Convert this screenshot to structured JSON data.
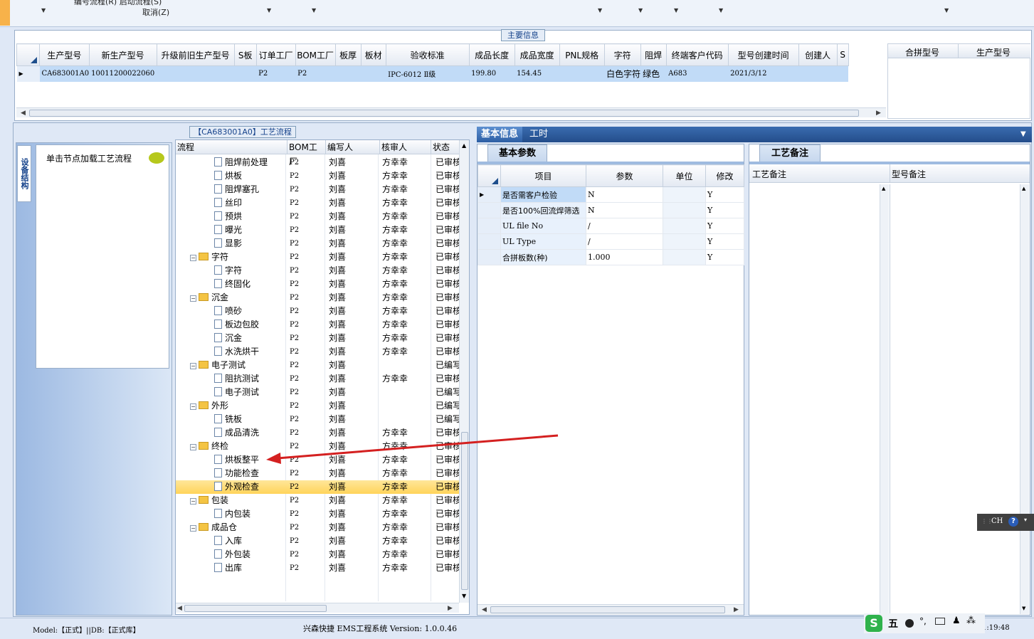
{
  "toolbar": {
    "line1": "编号流程(R)    启动流程(S)",
    "line2": "取消(Z)"
  },
  "main_info": {
    "caption": "主要信息",
    "columns": [
      "生产型号",
      "新生产型号",
      "升级前旧生产型号",
      "S板",
      "订单工厂",
      "BOM工厂",
      "板厚",
      "板材",
      "验收标准",
      "成品长度",
      "成品宽度",
      "PNL规格",
      "字符",
      "阻焊",
      "终端客户代码",
      "型号创建时间",
      "创建人",
      "S"
    ],
    "row": [
      "CA683001A0",
      "10011200022060",
      "",
      "",
      "P2",
      "P2",
      "",
      "",
      "IPC-6012 Ⅱ级",
      "199.80",
      "154.45",
      "",
      "白色字符",
      "绿色",
      "A683",
      "2021/3/12",
      "",
      ""
    ],
    "merge_columns": [
      "合拼型号",
      "生产型号"
    ]
  },
  "left": {
    "vertical_tab": "设备结构",
    "node_hint": "单击节点加载工艺流程"
  },
  "flow": {
    "caption": "【CA683001A0】工艺流程",
    "columns": [
      "流程",
      "BOM工厂",
      "编写人",
      "核审人",
      "状态"
    ],
    "rows": [
      {
        "level": 2,
        "type": "doc",
        "name": "阻焊前处理",
        "bom": "P2",
        "writer": "刘喜",
        "checker": "方幸幸",
        "status": "已审核"
      },
      {
        "level": 2,
        "type": "doc",
        "name": "烘板",
        "bom": "P2",
        "writer": "刘喜",
        "checker": "方幸幸",
        "status": "已审核"
      },
      {
        "level": 2,
        "type": "doc",
        "name": "阻焊塞孔",
        "bom": "P2",
        "writer": "刘喜",
        "checker": "方幸幸",
        "status": "已审核"
      },
      {
        "level": 2,
        "type": "doc",
        "name": "丝印",
        "bom": "P2",
        "writer": "刘喜",
        "checker": "方幸幸",
        "status": "已审核"
      },
      {
        "level": 2,
        "type": "doc",
        "name": "预烘",
        "bom": "P2",
        "writer": "刘喜",
        "checker": "方幸幸",
        "status": "已审核"
      },
      {
        "level": 2,
        "type": "doc",
        "name": "曝光",
        "bom": "P2",
        "writer": "刘喜",
        "checker": "方幸幸",
        "status": "已审核"
      },
      {
        "level": 2,
        "type": "doc",
        "name": "显影",
        "bom": "P2",
        "writer": "刘喜",
        "checker": "方幸幸",
        "status": "已审核"
      },
      {
        "level": 1,
        "type": "folder",
        "name": "字符",
        "bom": "P2",
        "writer": "刘喜",
        "checker": "方幸幸",
        "status": "已审核"
      },
      {
        "level": 2,
        "type": "doc",
        "name": "字符",
        "bom": "P2",
        "writer": "刘喜",
        "checker": "方幸幸",
        "status": "已审核"
      },
      {
        "level": 2,
        "type": "doc",
        "name": "终固化",
        "bom": "P2",
        "writer": "刘喜",
        "checker": "方幸幸",
        "status": "已审核"
      },
      {
        "level": 1,
        "type": "folder",
        "name": "沉金",
        "bom": "P2",
        "writer": "刘喜",
        "checker": "方幸幸",
        "status": "已审核"
      },
      {
        "level": 2,
        "type": "doc",
        "name": "喷砂",
        "bom": "P2",
        "writer": "刘喜",
        "checker": "方幸幸",
        "status": "已审核"
      },
      {
        "level": 2,
        "type": "doc",
        "name": "板边包胶",
        "bom": "P2",
        "writer": "刘喜",
        "checker": "方幸幸",
        "status": "已审核"
      },
      {
        "level": 2,
        "type": "doc",
        "name": "沉金",
        "bom": "P2",
        "writer": "刘喜",
        "checker": "方幸幸",
        "status": "已审核"
      },
      {
        "level": 2,
        "type": "doc",
        "name": "水洗烘干",
        "bom": "P2",
        "writer": "刘喜",
        "checker": "方幸幸",
        "status": "已审核"
      },
      {
        "level": 1,
        "type": "folder",
        "name": "电子测试",
        "bom": "P2",
        "writer": "刘喜",
        "checker": "",
        "status": "已编写"
      },
      {
        "level": 2,
        "type": "doc",
        "name": "阻抗测试",
        "bom": "P2",
        "writer": "刘喜",
        "checker": "方幸幸",
        "status": "已审核"
      },
      {
        "level": 2,
        "type": "doc",
        "name": "电子测试",
        "bom": "P2",
        "writer": "刘喜",
        "checker": "",
        "status": "已编写"
      },
      {
        "level": 1,
        "type": "folder",
        "name": "外形",
        "bom": "P2",
        "writer": "刘喜",
        "checker": "",
        "status": "已编写"
      },
      {
        "level": 2,
        "type": "doc",
        "name": "铣板",
        "bom": "P2",
        "writer": "刘喜",
        "checker": "",
        "status": "已编写"
      },
      {
        "level": 2,
        "type": "doc",
        "name": "成品清洗",
        "bom": "P2",
        "writer": "刘喜",
        "checker": "方幸幸",
        "status": "已审核"
      },
      {
        "level": 1,
        "type": "folder",
        "name": "终检",
        "bom": "P2",
        "writer": "刘喜",
        "checker": "方幸幸",
        "status": "已审核"
      },
      {
        "level": 2,
        "type": "doc",
        "name": "烘板整平",
        "bom": "P2",
        "writer": "刘喜",
        "checker": "方幸幸",
        "status": "已审核"
      },
      {
        "level": 2,
        "type": "doc",
        "name": "功能检查",
        "bom": "P2",
        "writer": "刘喜",
        "checker": "方幸幸",
        "status": "已审核"
      },
      {
        "level": 2,
        "type": "doc",
        "name": "外观检查",
        "bom": "P2",
        "writer": "刘喜",
        "checker": "方幸幸",
        "status": "已审核",
        "selected": true
      },
      {
        "level": 1,
        "type": "folder",
        "name": "包装",
        "bom": "P2",
        "writer": "刘喜",
        "checker": "方幸幸",
        "status": "已审核"
      },
      {
        "level": 2,
        "type": "doc",
        "name": "内包装",
        "bom": "P2",
        "writer": "刘喜",
        "checker": "方幸幸",
        "status": "已审核"
      },
      {
        "level": 1,
        "type": "folder",
        "name": "成品仓",
        "bom": "P2",
        "writer": "刘喜",
        "checker": "方幸幸",
        "status": "已审核"
      },
      {
        "level": 2,
        "type": "doc",
        "name": "入库",
        "bom": "P2",
        "writer": "刘喜",
        "checker": "方幸幸",
        "status": "已审核"
      },
      {
        "level": 2,
        "type": "doc",
        "name": "外包装",
        "bom": "P2",
        "writer": "刘喜",
        "checker": "方幸幸",
        "status": "已审核"
      },
      {
        "level": 2,
        "type": "doc",
        "name": "出库",
        "bom": "P2",
        "writer": "刘喜",
        "checker": "方幸幸",
        "status": "已审核"
      }
    ]
  },
  "right_tabs": [
    "基本信息",
    "工时"
  ],
  "params": {
    "tab": "基本参数",
    "columns": [
      "项目",
      "参数",
      "单位",
      "修改"
    ],
    "rows": [
      {
        "item": "是否需客户检验",
        "value": "N",
        "unit": "",
        "edit": "Y"
      },
      {
        "item": "是否100%回流焊筛选",
        "value": "N",
        "unit": "",
        "edit": "Y"
      },
      {
        "item": "UL file No",
        "value": "/",
        "unit": "",
        "edit": "Y"
      },
      {
        "item": "UL Type",
        "value": "/",
        "unit": "",
        "edit": "Y"
      },
      {
        "item": "合拼板数(种)",
        "value": "1.000",
        "unit": "",
        "edit": "Y"
      }
    ]
  },
  "notes": {
    "tab": "工艺备注",
    "col1": "工艺备注",
    "col2": "型号备注"
  },
  "status_bar": {
    "left": "Model:【正式】||DB:【正式库】",
    "center": "兴森快捷 EMS工程系统 Version: 1.0.0.46",
    "time": "1:19:48"
  },
  "ime": {
    "label": "CH",
    "tray_char": "五"
  },
  "colors": {
    "accent": "#244d8a",
    "selection": "#c1dbf7",
    "highlight": "#ffd45a",
    "arrow": "#d42020"
  }
}
